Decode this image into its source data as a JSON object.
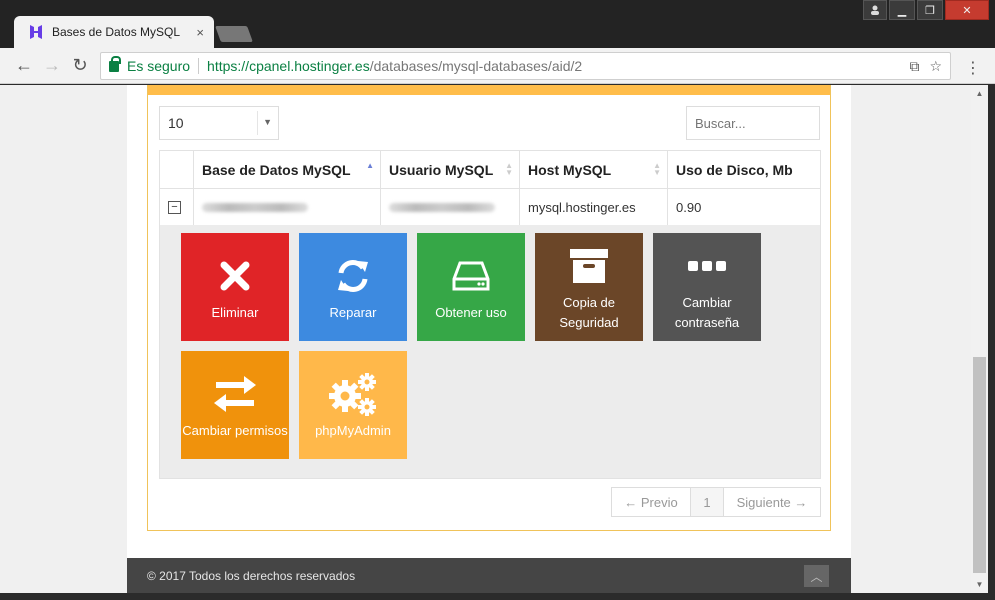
{
  "browser": {
    "tab_title": "Bases de Datos MySQL",
    "tab_close": "×",
    "secure_label": "Es seguro",
    "url_host": "https://cpanel.hostinger.es",
    "url_path": "/databases/mysql-databases/aid/2",
    "back": "←",
    "forward": "→",
    "reload": "↻",
    "translate_icon": "⧉",
    "star_icon": "☆",
    "menu_icon": "⋮",
    "win_minimize": "▁",
    "win_maximize": "❐",
    "win_close": "✕",
    "win_user": "👤"
  },
  "table_controls": {
    "page_length": "10",
    "search_placeholder": "Buscar..."
  },
  "table": {
    "columns": [
      "",
      "Base de Datos MySQL",
      "Usuario MySQL",
      "Host MySQL",
      "Uso de Disco, Mb"
    ],
    "row": {
      "host": "mysql.hostinger.es",
      "disk": "0.90"
    }
  },
  "actions": [
    {
      "label": "Eliminar",
      "icon": "close-icon",
      "color": "#e02427"
    },
    {
      "label": "Reparar",
      "icon": "refresh-icon",
      "color": "#3d8ae0"
    },
    {
      "label": "Obtener uso",
      "icon": "hard-drive-icon",
      "color": "#36a747"
    },
    {
      "label": "Copia de Seguridad",
      "icon": "archive-icon",
      "color": "#6b4628"
    },
    {
      "label": "Cambiar contraseña",
      "icon": "password-dots-icon",
      "color": "#545454"
    },
    {
      "label": "Cambiar permisos",
      "icon": "exchange-icon",
      "color": "#f0920c"
    },
    {
      "label": "phpMyAdmin",
      "icon": "gears-icon",
      "color": "#ffb84a"
    }
  ],
  "pagination": {
    "prev": "← Previo",
    "current": "1",
    "next": "Siguiente →"
  },
  "footer": {
    "copyright": "© 2017 Todos los derechos reservados",
    "to_top": "︿"
  }
}
